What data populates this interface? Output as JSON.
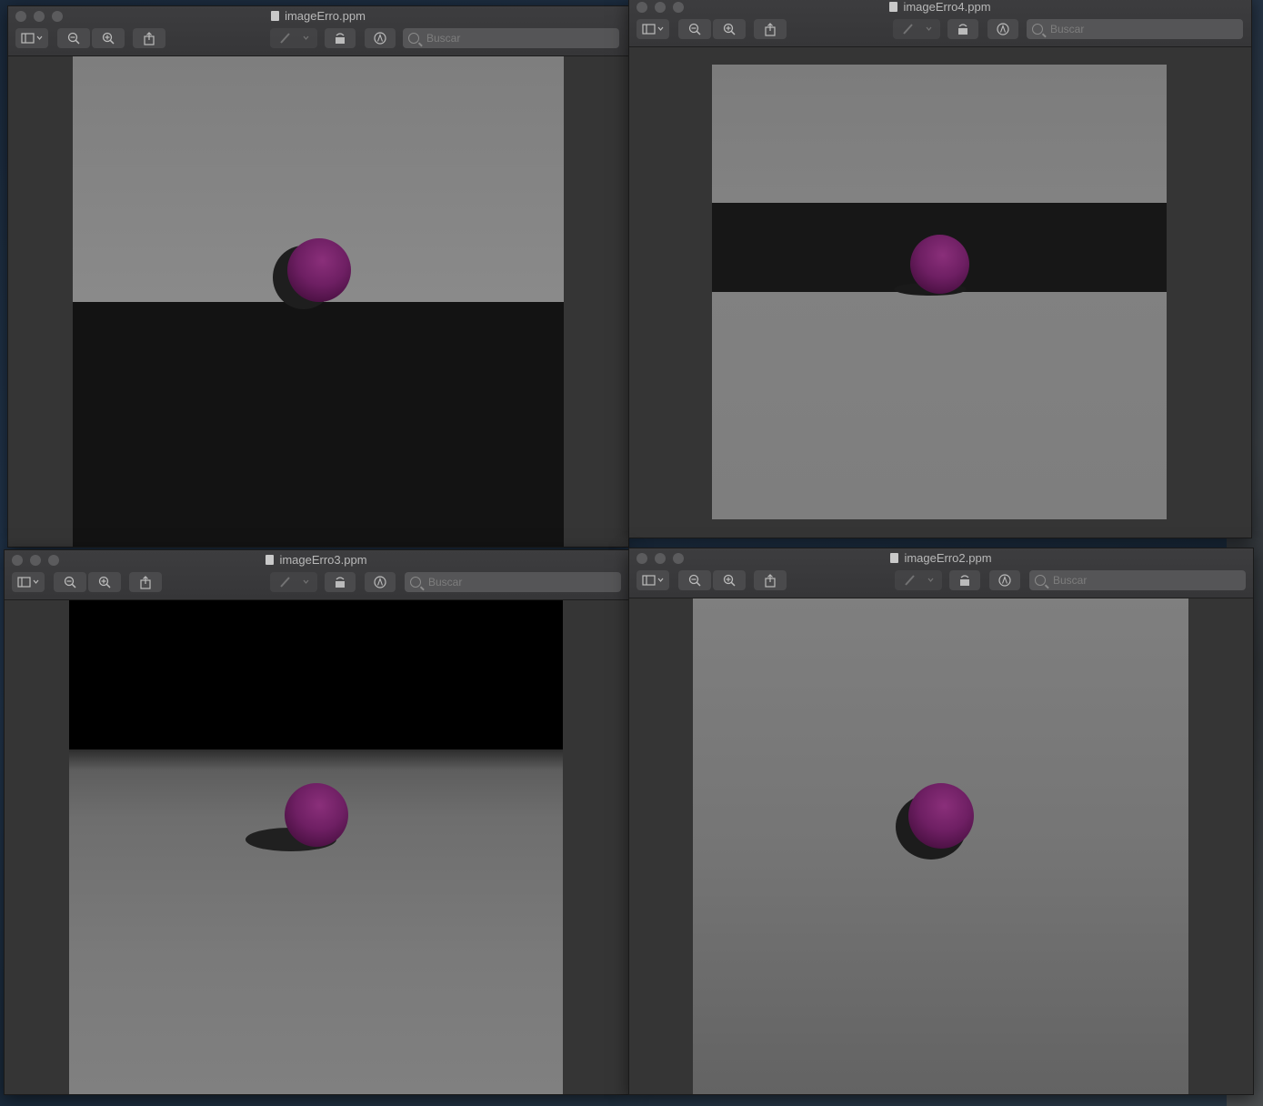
{
  "desktop": {
    "background": "#1f3247"
  },
  "windows": [
    {
      "id": "w1",
      "title": "imageErro.ppm",
      "search_placeholder": "Buscar"
    },
    {
      "id": "w2",
      "title": "imageErro4.ppm",
      "search_placeholder": "Buscar"
    },
    {
      "id": "w3",
      "title": "imageErro3.ppm",
      "search_placeholder": "Buscar"
    },
    {
      "id": "w4",
      "title": "imageErro2.ppm",
      "search_placeholder": "Buscar"
    }
  ],
  "toolbar_icons": [
    "sidebar-icon",
    "zoom-out-icon",
    "zoom-in-icon",
    "share-icon",
    "markup-pen-icon",
    "rotate-icon",
    "annotate-icon",
    "search-icon"
  ],
  "colors": {
    "sphere": "#6e1f63",
    "window_bg": "#353535",
    "titlebar": "#3a3a3c"
  }
}
